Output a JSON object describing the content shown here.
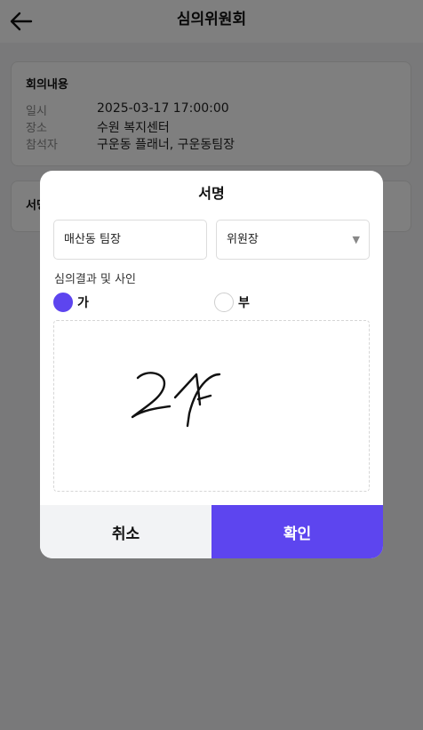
{
  "header": {
    "title": "심의위원회"
  },
  "meeting": {
    "title": "회의내용",
    "rows": [
      {
        "label": "일시",
        "value": "2025-03-17 17:00:00"
      },
      {
        "label": "장소",
        "value": "수원 복지센터"
      },
      {
        "label": "참석자",
        "value": "구운동 플래너, 구운동팀장"
      }
    ]
  },
  "sign_section": {
    "title": "서명"
  },
  "modal": {
    "title": "서명",
    "name_value": "매산동 팀장",
    "role_value": "위원장",
    "result_label": "심의결과 및 사인",
    "options": [
      {
        "label": "가",
        "selected": true
      },
      {
        "label": "부",
        "selected": false
      }
    ],
    "signature_text": "2H",
    "cancel_label": "취소",
    "confirm_label": "확인"
  },
  "colors": {
    "accent": "#5d45ef",
    "overlay": "rgba(0,0,0,0.5)"
  }
}
